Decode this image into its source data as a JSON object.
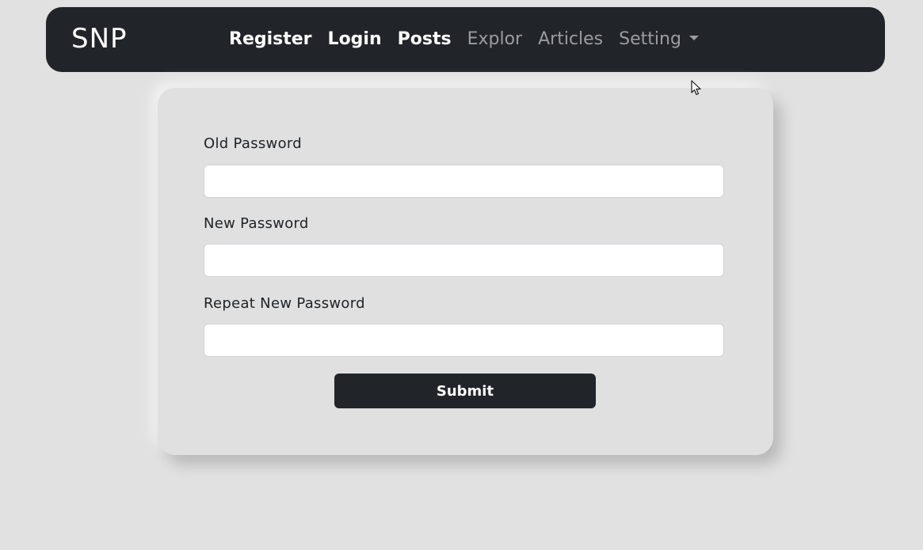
{
  "navbar": {
    "brand": "SNP",
    "items": [
      {
        "label": "Register",
        "state": "active"
      },
      {
        "label": "Login",
        "state": "active"
      },
      {
        "label": "Posts",
        "state": "active"
      },
      {
        "label": "Explor",
        "state": "muted"
      },
      {
        "label": "Articles",
        "state": "muted"
      },
      {
        "label": "Setting",
        "state": "muted",
        "dropdown": true
      }
    ]
  },
  "form": {
    "old_password_label": "Old Password",
    "old_password_value": "",
    "new_password_label": "New Password",
    "new_password_value": "",
    "repeat_password_label": "Repeat New Password",
    "repeat_password_value": "",
    "submit_label": "Submit"
  },
  "colors": {
    "background": "#e1e1e1",
    "navbar": "#212429",
    "card": "#e0e0e0",
    "nav_active": "#ffffff",
    "nav_muted": "#9a9ca0",
    "button": "#212429"
  },
  "icons": {
    "dropdown": "chevron-down-icon",
    "cursor": "mouse-pointer-icon"
  }
}
